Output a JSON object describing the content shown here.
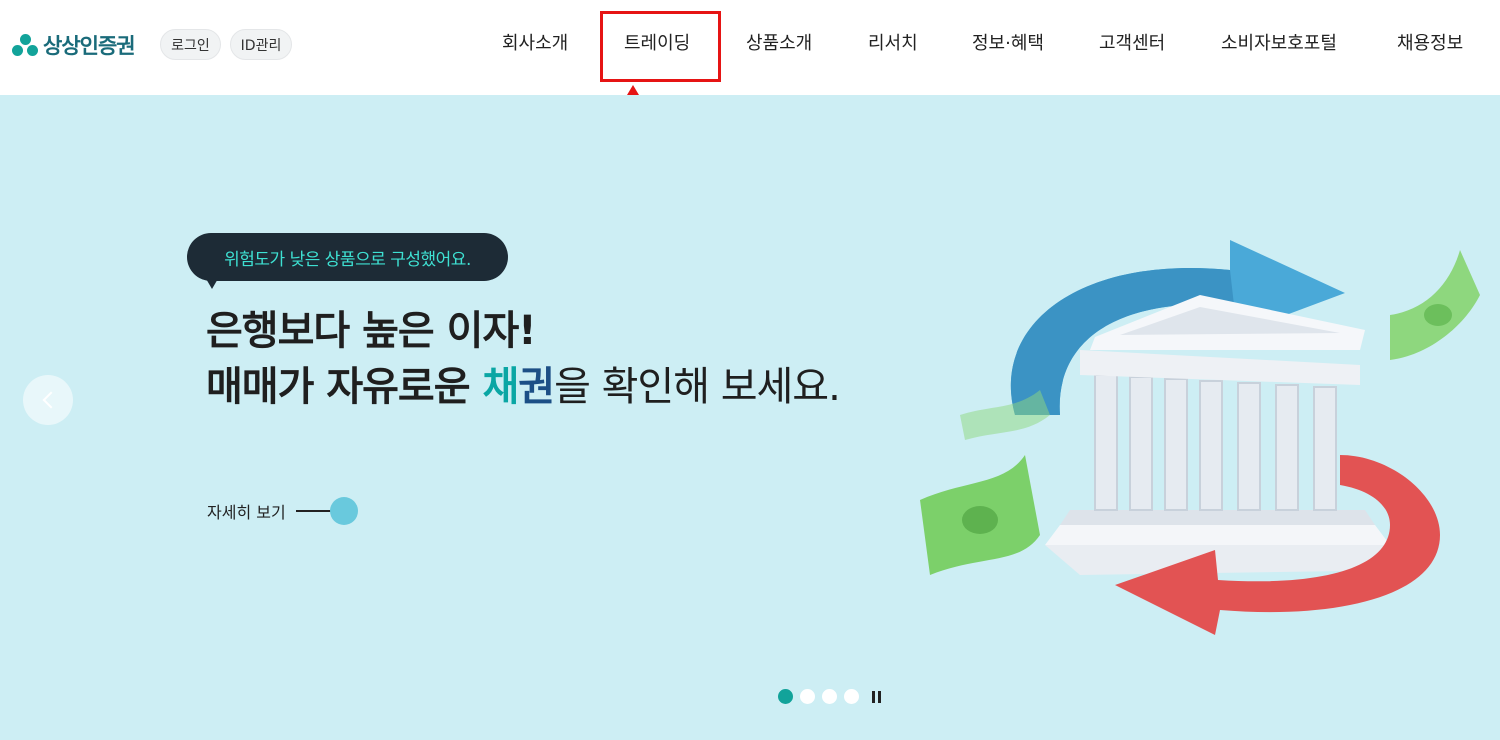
{
  "header": {
    "brand": "상상인증권",
    "login_label": "로그인",
    "id_manage_label": "ID관리",
    "nav": [
      {
        "label": "회사소개"
      },
      {
        "label": "트레이딩"
      },
      {
        "label": "상품소개"
      },
      {
        "label": "리서치"
      },
      {
        "label": "정보·혜택"
      },
      {
        "label": "고객센터"
      },
      {
        "label": "소비자보호포털"
      },
      {
        "label": "채용정보"
      }
    ]
  },
  "hero": {
    "bubble_text": "위험도가 낮은 상품으로 구성했어요.",
    "headline_line1": "은행보다 높은 이자!",
    "headline_line2_bold": "매매가 자유로운 ",
    "headline_accent1": "채",
    "headline_accent2": "권",
    "headline_line2_rest": "을 확인해 보세요.",
    "more_label": "자세히 보기",
    "slides_total": 4,
    "slide_active": 1
  },
  "colors": {
    "brand": "#12a39a",
    "hero_bg": "#cdeef4",
    "annotation": "#e61414",
    "bubble_bg": "#1d2b36",
    "bubble_text": "#3ee0d2"
  },
  "icons": {
    "logo": "logo-dots-icon",
    "prev": "chevron-left-icon",
    "more": "arrow-right-icon",
    "pause": "pause-icon"
  }
}
